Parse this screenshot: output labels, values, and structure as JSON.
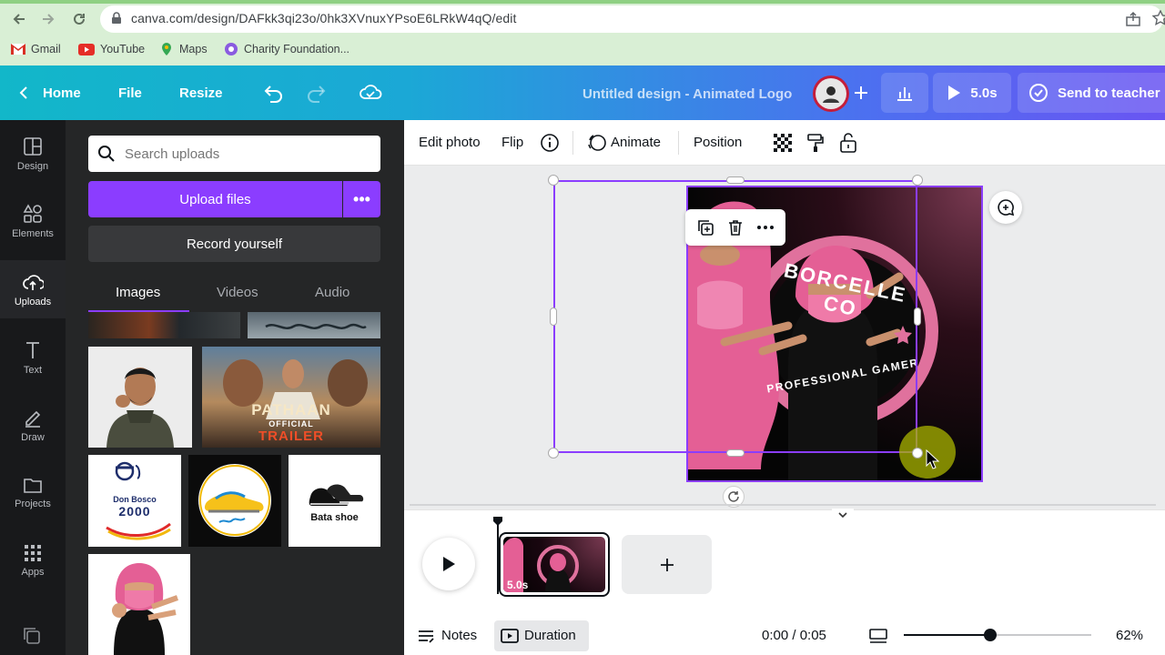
{
  "browser": {
    "url": "canva.com/design/DAFkk3qi23o/0hk3XVnuxYPsoE6LRkW4qQ/edit",
    "bookmarks": [
      "Gmail",
      "YouTube",
      "Maps",
      "Charity Foundation..."
    ]
  },
  "topbar": {
    "home": "Home",
    "file": "File",
    "resize": "Resize",
    "title": "Untitled design - Animated Logo",
    "play_duration": "5.0s",
    "send": "Send to teacher"
  },
  "rail": {
    "items": [
      "Design",
      "Elements",
      "Uploads",
      "Text",
      "Draw",
      "Projects",
      "Apps"
    ]
  },
  "panel": {
    "search_placeholder": "Search uploads",
    "upload_files": "Upload files",
    "more": "•••",
    "record": "Record yourself",
    "tabs": [
      "Images",
      "Videos",
      "Audio"
    ],
    "thumbs": {
      "pathaan_title": "PATHAAN",
      "pathaan_sub": "OFFICIAL",
      "pathaan_trailer": "TRAILER",
      "donbosco_line1": "Don Bosco",
      "donbosco_line2": "2000",
      "bata": "Bata shoe"
    }
  },
  "edit_toolbar": {
    "edit_photo": "Edit photo",
    "flip": "Flip",
    "animate": "Animate",
    "position": "Position"
  },
  "logo": {
    "top_text": "BORCELLE CO",
    "bottom_text": "PROFESSIONAL GAMER"
  },
  "timeline": {
    "clip_duration": "5.0s"
  },
  "bottom": {
    "notes": "Notes",
    "duration": "Duration",
    "time": "0:00 / 0:05",
    "zoom": "62%",
    "zoom_level": 0.62
  },
  "colors": {
    "accent": "#8b3dff",
    "pink": "#e0719d"
  }
}
